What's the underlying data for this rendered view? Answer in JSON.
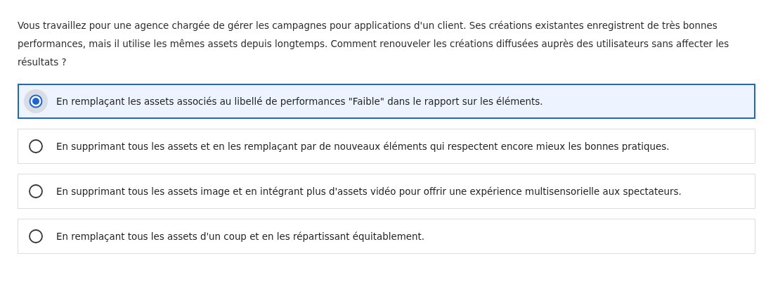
{
  "question": "Vous travaillez pour une agence chargée de gérer les campagnes pour applications d'un client. Ses créations existantes enregistrent de très bonnes performances, mais il utilise les mêmes assets depuis longtemps. Comment renouveler les créations diffusées auprès des utilisateurs sans affecter les résultats ?",
  "options": [
    {
      "label": "En remplaçant les assets associés au libellé de performances \"Faible\" dans le rapport sur les éléments.",
      "selected": true
    },
    {
      "label": "En supprimant tous les assets et en les remplaçant par de nouveaux éléments qui respectent encore mieux les bonnes pratiques.",
      "selected": false
    },
    {
      "label": "En supprimant tous les assets image et en intégrant plus d'assets vidéo pour offrir une expérience multisensorielle aux spectateurs.",
      "selected": false
    },
    {
      "label": "En remplaçant tous les assets d'un coup et en les répartissant équitablement.",
      "selected": false
    }
  ]
}
